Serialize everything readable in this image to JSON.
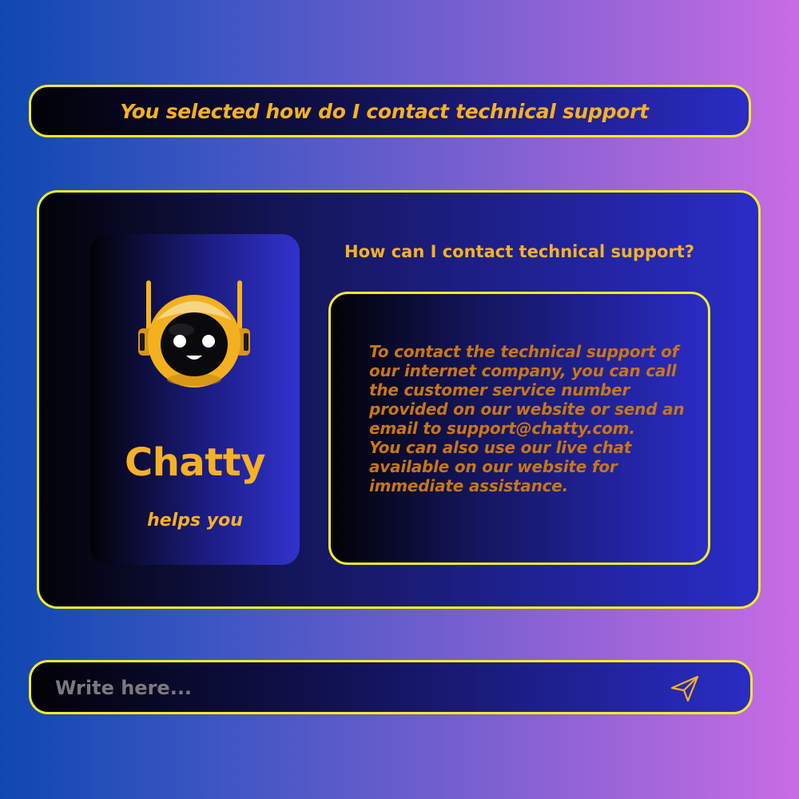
{
  "banner": {
    "text": "You selected how do I contact technical support"
  },
  "bot": {
    "name": "Chatty",
    "tagline": "helps you",
    "avatar_icon": "robot-mascot-icon"
  },
  "conversation": {
    "question": "How can I contact technical support?",
    "answer": "To contact the technical support of our internet company, you can call the customer service number provided on our website or send an email to support@chatty.com.\n  You can also use our live chat available on our website for immediate assistance."
  },
  "composer": {
    "placeholder": "Write here...",
    "send_icon": "send-icon"
  },
  "colors": {
    "accent_yellow": "#f2ea2a",
    "text_gold": "#f5b126",
    "answer_orange": "#c87618",
    "navy": "#14165a",
    "indigo": "#2a2cc6"
  }
}
